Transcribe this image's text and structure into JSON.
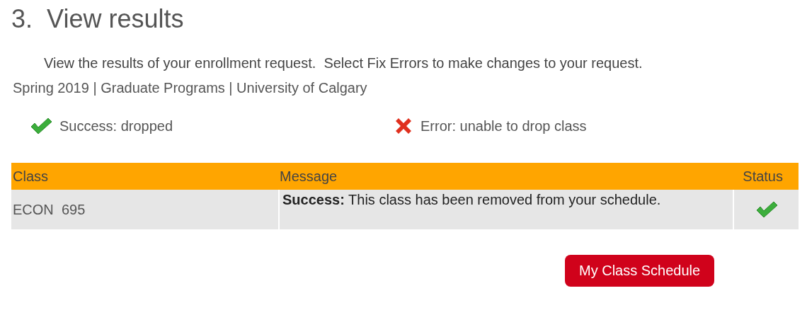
{
  "heading": {
    "number": "3.",
    "title": "View results"
  },
  "instructions": "View the results of your enrollment request.  Select Fix Errors to make changes to your request.",
  "term": "Spring 2019 | Graduate Programs | University of Calgary",
  "legend": [
    {
      "kind": "success",
      "label": "Success: dropped"
    },
    {
      "kind": "error",
      "label": "Error: unable to drop class"
    }
  ],
  "table": {
    "columns": [
      "Class",
      "Message",
      "Status"
    ],
    "rows": [
      {
        "class": "ECON  695",
        "message": "**Success:** This class has been removed from your schedule.",
        "succeeded": true
      }
    ]
  },
  "button": "My Class Schedule"
}
